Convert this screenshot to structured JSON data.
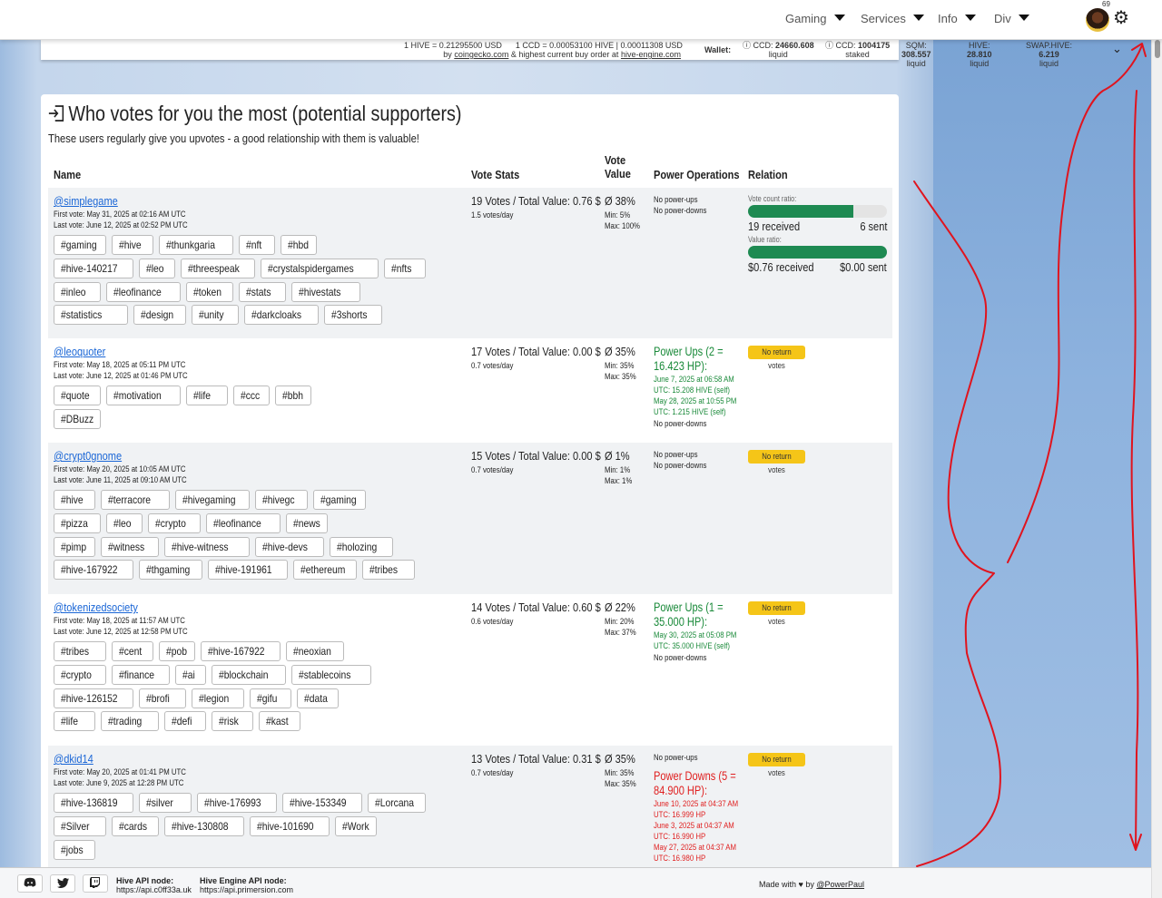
{
  "nav": {
    "items": [
      {
        "label": "Gaming"
      },
      {
        "label": "Services"
      },
      {
        "label": "Info"
      },
      {
        "label": "Div"
      }
    ],
    "notification_count": "69"
  },
  "pricebar": {
    "line1": "1 HIVE = 0.21295500 USD      1 CCD = 0.00053100 HIVE | 0.00011308 USD",
    "line2_prefix": "by",
    "line2_link1": "coingecko.com",
    "line2_mid": "& highest current buy order at",
    "line2_link2": "hive-engine.com",
    "wallet_label": "Wallet:",
    "stats": [
      {
        "label": "CCD:",
        "value": "24660.608",
        "sub": "liquid",
        "info": true
      },
      {
        "label": "CCD:",
        "value": "1004175",
        "sub": "staked",
        "info": true
      },
      {
        "label": "SQM:",
        "value": "308.557",
        "sub": "liquid",
        "info": false
      },
      {
        "label": "HIVE:",
        "value": "28.810",
        "sub": "liquid",
        "info": false
      },
      {
        "label": "SWAP.HIVE:",
        "value": "6.219",
        "sub": "liquid",
        "info": false
      }
    ]
  },
  "card": {
    "title": "Who votes for you the most (potential supporters)",
    "subtitle": "These users regularly give you upvotes - a good relationship with them is valuable!",
    "headers": {
      "name": "Name",
      "vote_stats": "Vote Stats",
      "vote_value_1": "Vote",
      "vote_value_2": "Value",
      "power_ops": "Power Operations",
      "relation": "Relation"
    }
  },
  "rows": [
    {
      "name": "@simplegame",
      "first_vote": "First vote: May 31, 2025 at 02:16 AM UTC",
      "last_vote": "Last vote: June 12, 2025 at 02:52 PM UTC",
      "tags": [
        [
          "#gaming",
          "#hive",
          "#thunkgaria",
          "#nft",
          "#hbd"
        ],
        [
          "#hive-140217",
          "#leo",
          "#threespeak",
          "#crystalspidergames",
          "#nfts"
        ],
        [
          "#inleo",
          "#leofinance",
          "#token",
          "#stats",
          "#hivestats"
        ],
        [
          "#statistics",
          "#design",
          "#unity",
          "#darkcloaks",
          "#3shorts"
        ]
      ],
      "votes": "19 Votes / Total Value: 0.76 $",
      "votes_per_day": "1.5 votes/day",
      "vote_value": "Ø 38%",
      "min": "Min: 5%",
      "max": "Max: 100%",
      "power_lines": [
        "No power-ups",
        "No power-downs"
      ],
      "relation": {
        "count_label": "Vote count ratio:",
        "count_fraction": 0.76,
        "received": "19 received",
        "sent": "6 sent",
        "value_label": "Value ratio:",
        "value_fraction": 1.0,
        "value_received": "$0.76 received",
        "value_sent": "$0.00 sent"
      }
    },
    {
      "name": "@leoquoter",
      "first_vote": "First vote: May 18, 2025 at 05:11 PM UTC",
      "last_vote": "Last vote: June 12, 2025 at 01:46 PM UTC",
      "tags": [
        [
          "#quote",
          "#motivation",
          "#life",
          "#ccc",
          "#bbh"
        ],
        [
          "#DBuzz"
        ]
      ],
      "votes": "17 Votes / Total Value: 0.00 $",
      "votes_per_day": "0.7 votes/day",
      "vote_value": "Ø 35%",
      "min": "Min: 35%",
      "max": "Max: 35%",
      "power_ups_title": "Power Ups (2 =",
      "power_ups_title2": "16.423 HP):",
      "power_up_lines": [
        "June 7, 2025 at 06:58 AM",
        "UTC: 15.208 HIVE (self)",
        "May 28, 2025 at 10:55 PM",
        "UTC: 1.215 HIVE (self)"
      ],
      "power_down_line": "No power-downs",
      "badge": "No return votes"
    },
    {
      "name": "@crypt0gnome",
      "first_vote": "First vote: May 20, 2025 at 10:05 AM UTC",
      "last_vote": "Last vote: June 11, 2025 at 09:10 AM UTC",
      "tags": [
        [
          "#hive",
          "#terracore",
          "#hivegaming",
          "#hivegc",
          "#gaming"
        ],
        [
          "#pizza",
          "#leo",
          "#crypto",
          "#leofinance",
          "#news"
        ],
        [
          "#pimp",
          "#witness",
          "#hive-witness",
          "#hive-devs",
          "#holozing"
        ],
        [
          "#hive-167922",
          "#thgaming",
          "#hive-191961",
          "#ethereum",
          "#tribes"
        ]
      ],
      "votes": "15 Votes / Total Value: 0.00 $",
      "votes_per_day": "0.7 votes/day",
      "vote_value": "Ø 1%",
      "min": "Min: 1%",
      "max": "Max: 1%",
      "power_lines": [
        "No power-ups",
        "No power-downs"
      ],
      "badge": "No return votes"
    },
    {
      "name": "@tokenizedsociety",
      "first_vote": "First vote: May 18, 2025 at 11:57 AM UTC",
      "last_vote": "Last vote: June 12, 2025 at 12:58 PM UTC",
      "tags": [
        [
          "#tribes",
          "#cent",
          "#pob",
          "#hive-167922",
          "#neoxian"
        ],
        [
          "#crypto",
          "#finance",
          "#ai",
          "#blockchain",
          "#stablecoins"
        ],
        [
          "#hive-126152",
          "#brofi",
          "#legion",
          "#gifu",
          "#data"
        ],
        [
          "#life",
          "#trading",
          "#defi",
          "#risk",
          "#kast"
        ]
      ],
      "votes": "14 Votes / Total Value: 0.60 $",
      "votes_per_day": "0.6 votes/day",
      "vote_value": "Ø 22%",
      "min": "Min: 20%",
      "max": "Max: 37%",
      "power_ups_title": "Power Ups (1 =",
      "power_ups_title2": "35.000 HP):",
      "power_up_lines": [
        "May 30, 2025 at 05:08 PM",
        "UTC: 35.000 HIVE (self)"
      ],
      "power_down_line": "No power-downs",
      "badge": "No return votes"
    },
    {
      "name": "@dkid14",
      "first_vote": "First vote: May 20, 2025 at 01:41 PM UTC",
      "last_vote": "Last vote: June 9, 2025 at 12:28 PM UTC",
      "tags": [
        [
          "#hive-136819",
          "#silver",
          "#hive-176993",
          "#hive-153349",
          "#Lorcana"
        ],
        [
          "#Silver",
          "#cards",
          "#hive-130808",
          "#hive-101690",
          "#Work"
        ],
        [
          "#jobs"
        ]
      ],
      "votes": "13 Votes / Total Value: 0.31 $",
      "votes_per_day": "0.7 votes/day",
      "vote_value": "Ø 35%",
      "min": "Min: 35%",
      "max": "Max: 35%",
      "power_up_line": "No power-ups",
      "power_downs_title": "Power Downs (5 =",
      "power_downs_title2": "84.900 HP):",
      "power_down_lines": [
        "June 10, 2025 at 04:37 AM",
        "UTC: 16.999 HP",
        "June 3, 2025 at 04:37 AM",
        "UTC: 16.990 HP",
        "May 27, 2025 at 04:37 AM",
        "UTC: 16.980 HP"
      ],
      "badge": "No return votes"
    }
  ],
  "footer": {
    "hive_api_label": "Hive API node:",
    "hive_api_value": "https://api.c0ff33a.uk",
    "he_api_label": "Hive Engine API node:",
    "he_api_value": "https://api.primersion.com",
    "made_with": "Made with ♥ by",
    "made_by": "@PowerPaul"
  },
  "colors": {
    "link": "#1a66d6",
    "power_up_green": "#1a8a3a",
    "power_down_red": "#e02020",
    "bar_green": "#1e8a52",
    "badge_yellow": "#f5c518",
    "annotation_red": "#e0141e"
  },
  "icons": [
    "gear-icon",
    "avatar",
    "login-icon",
    "discord-icon",
    "twitter-icon",
    "twitch-icon",
    "info-icon",
    "chevron-down-icon"
  ]
}
